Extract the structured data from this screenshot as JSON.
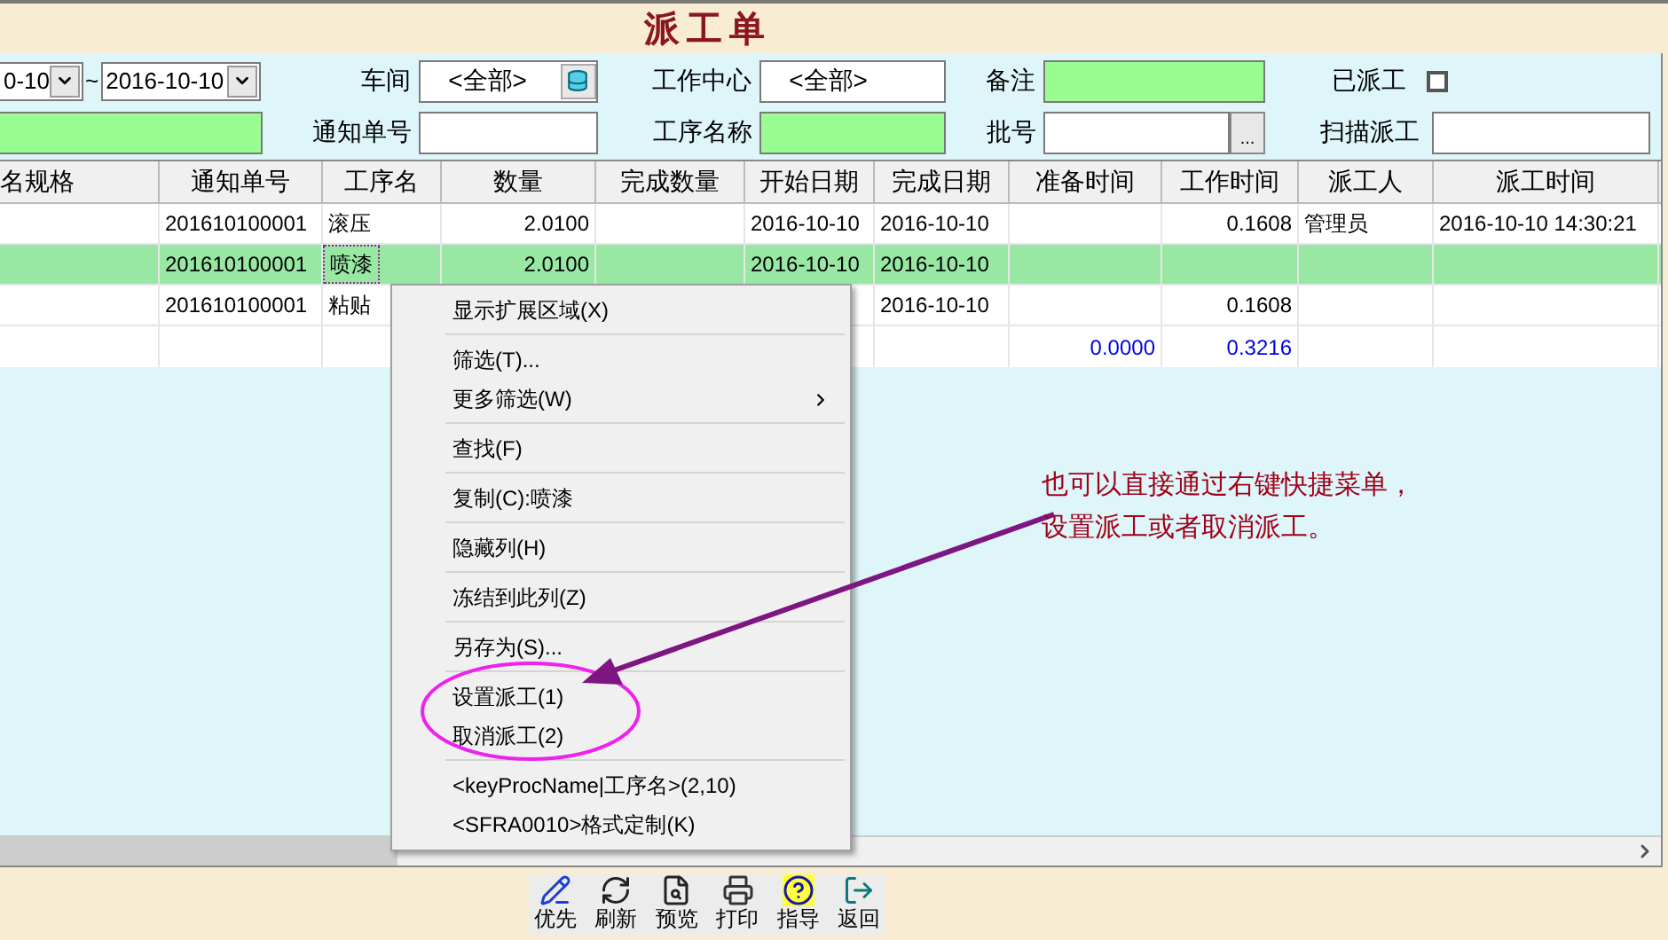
{
  "window": {
    "title": "派工单"
  },
  "filters": {
    "date_from": "0-10",
    "range_sep": "~",
    "date_to": "2016-10-10",
    "workshop": {
      "label": "车间",
      "value": "<全部>"
    },
    "work_center": {
      "label": "工作中心",
      "value": "<全部>"
    },
    "remark": {
      "label": "备注"
    },
    "dispatched": {
      "label": "已派工",
      "checked": false
    },
    "notice_no": {
      "label": "通知单号"
    },
    "process_name": {
      "label": "工序名称"
    },
    "batch_no": {
      "label": "批号",
      "button": "..."
    },
    "scan_dispatch": {
      "label": "扫描派工"
    }
  },
  "table": {
    "columns": [
      {
        "label": "名规格"
      },
      {
        "label": "通知单号",
        "kind": "text"
      },
      {
        "label": "工序名",
        "kind": "text"
      },
      {
        "label": "数量",
        "kind": "number"
      },
      {
        "label": "完成数量"
      },
      {
        "label": "开始日期",
        "kind": "text"
      },
      {
        "label": "完成日期",
        "kind": "text"
      },
      {
        "label": "准备时间",
        "kind": "number",
        "total": "0.0000"
      },
      {
        "label": "工作时间",
        "kind": "number",
        "total": "0.3216"
      },
      {
        "label": "派工人",
        "kind": "text"
      },
      {
        "label": "派工时间",
        "kind": "text"
      }
    ],
    "rows": [
      {
        "selected": false,
        "cells": [
          null,
          {
            "text": "201610100001",
            "focused": false
          },
          {
            "text": "滚压",
            "focused": false
          },
          {
            "text": "2.0100",
            "focused": false
          },
          null,
          {
            "text": "2016-10-10",
            "focused": false
          },
          {
            "text": "2016-10-10",
            "focused": false
          },
          null,
          {
            "text": "0.1608",
            "focused": false
          },
          {
            "text": "管理员",
            "focused": false
          },
          {
            "text": "2016-10-10 14:30:21",
            "focused": false
          }
        ]
      },
      {
        "selected": true,
        "cells": [
          null,
          {
            "text": "201610100001",
            "focused": false
          },
          {
            "text": "喷漆",
            "focused": true
          },
          {
            "text": "2.0100",
            "focused": false
          },
          null,
          {
            "text": "2016-10-10",
            "focused": false
          },
          {
            "text": "2016-10-10",
            "focused": false
          },
          null,
          null,
          null,
          null
        ]
      },
      {
        "selected": false,
        "cells": [
          null,
          {
            "text": "201610100001",
            "focused": false
          },
          {
            "text": "粘贴",
            "focused": false
          },
          null,
          null,
          null,
          {
            "text": "2016-10-10",
            "focused": false
          },
          null,
          {
            "text": "0.1608",
            "focused": false
          },
          null,
          null
        ]
      }
    ]
  },
  "context_menu": {
    "groups": [
      [
        {
          "label": "显示扩展区域(X)",
          "submenu": false
        }
      ],
      [
        {
          "label": "筛选(T)...",
          "submenu": false
        },
        {
          "label": "更多筛选(W)",
          "submenu": true
        }
      ],
      [
        {
          "label": "查找(F)",
          "submenu": false
        }
      ],
      [
        {
          "label": "复制(C):喷漆",
          "submenu": false
        }
      ],
      [
        {
          "label": "隐藏列(H)",
          "submenu": false
        }
      ],
      [
        {
          "label": "冻结到此列(Z)",
          "submenu": false
        }
      ],
      [
        {
          "label": "另存为(S)...",
          "submenu": false
        }
      ],
      [
        {
          "label": "设置派工(1)",
          "submenu": false
        },
        {
          "label": "取消派工(2)",
          "submenu": false
        }
      ],
      [
        {
          "label": "<keyProcName|工序名>(2,10)",
          "submenu": false
        },
        {
          "label": "<SFRA0010>格式定制(K)",
          "submenu": false
        }
      ]
    ]
  },
  "annotation": {
    "lines": [
      "也可以直接通过右键快捷菜单，",
      "设置派工或者取消派工。"
    ]
  },
  "toolbar": [
    {
      "label": "优先",
      "kind": "priority"
    },
    {
      "label": "刷新",
      "kind": "refresh"
    },
    {
      "label": "预览",
      "kind": "preview"
    },
    {
      "label": "打印",
      "kind": "print"
    },
    {
      "label": "指导",
      "kind": "help"
    },
    {
      "label": "返回",
      "kind": "exit"
    }
  ]
}
